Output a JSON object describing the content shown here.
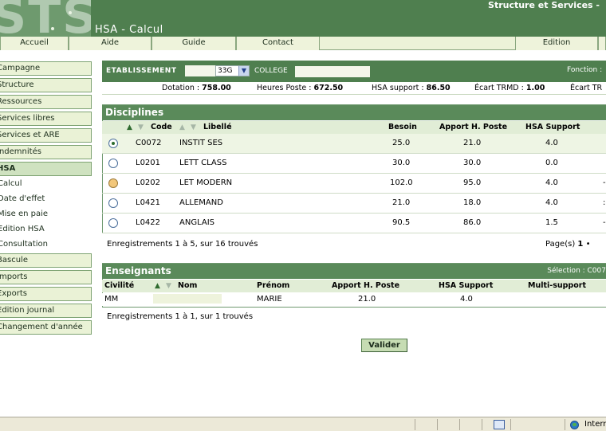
{
  "header": {
    "logo_text": "STS",
    "brand": "Structure et Services -",
    "page_title": "HSA - Calcul"
  },
  "topnav": {
    "items": [
      "Accueil",
      "Aide",
      "Guide",
      "Contact"
    ],
    "edition": "Edition"
  },
  "sidebar": {
    "items": [
      "Campagne",
      "Structure",
      "Ressources",
      "Services libres",
      "Services et ARE",
      "Indemnités",
      "HSA"
    ],
    "sub_items": [
      "Calcul",
      "Date d'effet",
      "Mise en paie",
      "Edition HSA",
      "Consultation"
    ],
    "items_after": [
      "Bascule",
      "Imports",
      "Exports",
      "Edition journal",
      "Changement d'année"
    ]
  },
  "establishment": {
    "label": "ETABLISSEMENT",
    "code_suffix": "33G",
    "college_label": "COLLEGE",
    "fonction": "Fonction :"
  },
  "stats": {
    "dotation_label": "Dotation :",
    "dotation": "758.00",
    "heures_label": "Heures Poste :",
    "heures": "672.50",
    "hsa_label": "HSA support :",
    "hsa": "86.50",
    "ecart_label": "Écart TRMD :",
    "ecart": "1.00",
    "ecart2_label": "Écart TR"
  },
  "disciplines": {
    "title": "Disciplines",
    "columns": {
      "code": "Code",
      "libelle": "Libellé",
      "besoin": "Besoin",
      "apport": "Apport H. Poste",
      "hsa": "HSA Support"
    },
    "rows": [
      {
        "code": "C0072",
        "libelle": "INSTIT SES",
        "besoin": "25.0",
        "apport": "21.0",
        "hsa": "4.0",
        "extra": ""
      },
      {
        "code": "L0201",
        "libelle": "LETT CLASS",
        "besoin": "30.0",
        "apport": "30.0",
        "hsa": "0.0",
        "extra": ""
      },
      {
        "code": "L0202",
        "libelle": "LET MODERN",
        "besoin": "102.0",
        "apport": "95.0",
        "hsa": "4.0",
        "extra": "-"
      },
      {
        "code": "L0421",
        "libelle": "ALLEMAND",
        "besoin": "21.0",
        "apport": "18.0",
        "hsa": "4.0",
        "extra": ":"
      },
      {
        "code": "L0422",
        "libelle": "ANGLAIS",
        "besoin": "90.5",
        "apport": "86.0",
        "hsa": "1.5",
        "extra": "-"
      }
    ],
    "records": "Enregistrements 1 à 5, sur 16 trouvés",
    "pager_label": "Page(s)",
    "pager_current": "1",
    "pager_more": "•"
  },
  "enseignants": {
    "title": "Enseignants",
    "selection": "Sélection : C007",
    "columns": {
      "civilite": "Civilité",
      "nom": "Nom",
      "prenom": "Prénom",
      "apport": "Apport H. Poste",
      "hsa": "HSA Support",
      "multi": "Multi-support"
    },
    "rows": [
      {
        "civilite": "MM",
        "prenom": "MARIE",
        "apport": "21.0",
        "hsa": "4.0"
      }
    ],
    "records": "Enregistrements 1 à 1, sur 1 trouvés"
  },
  "actions": {
    "validate": "Valider"
  },
  "statusbar": {
    "zone": "Interr"
  }
}
